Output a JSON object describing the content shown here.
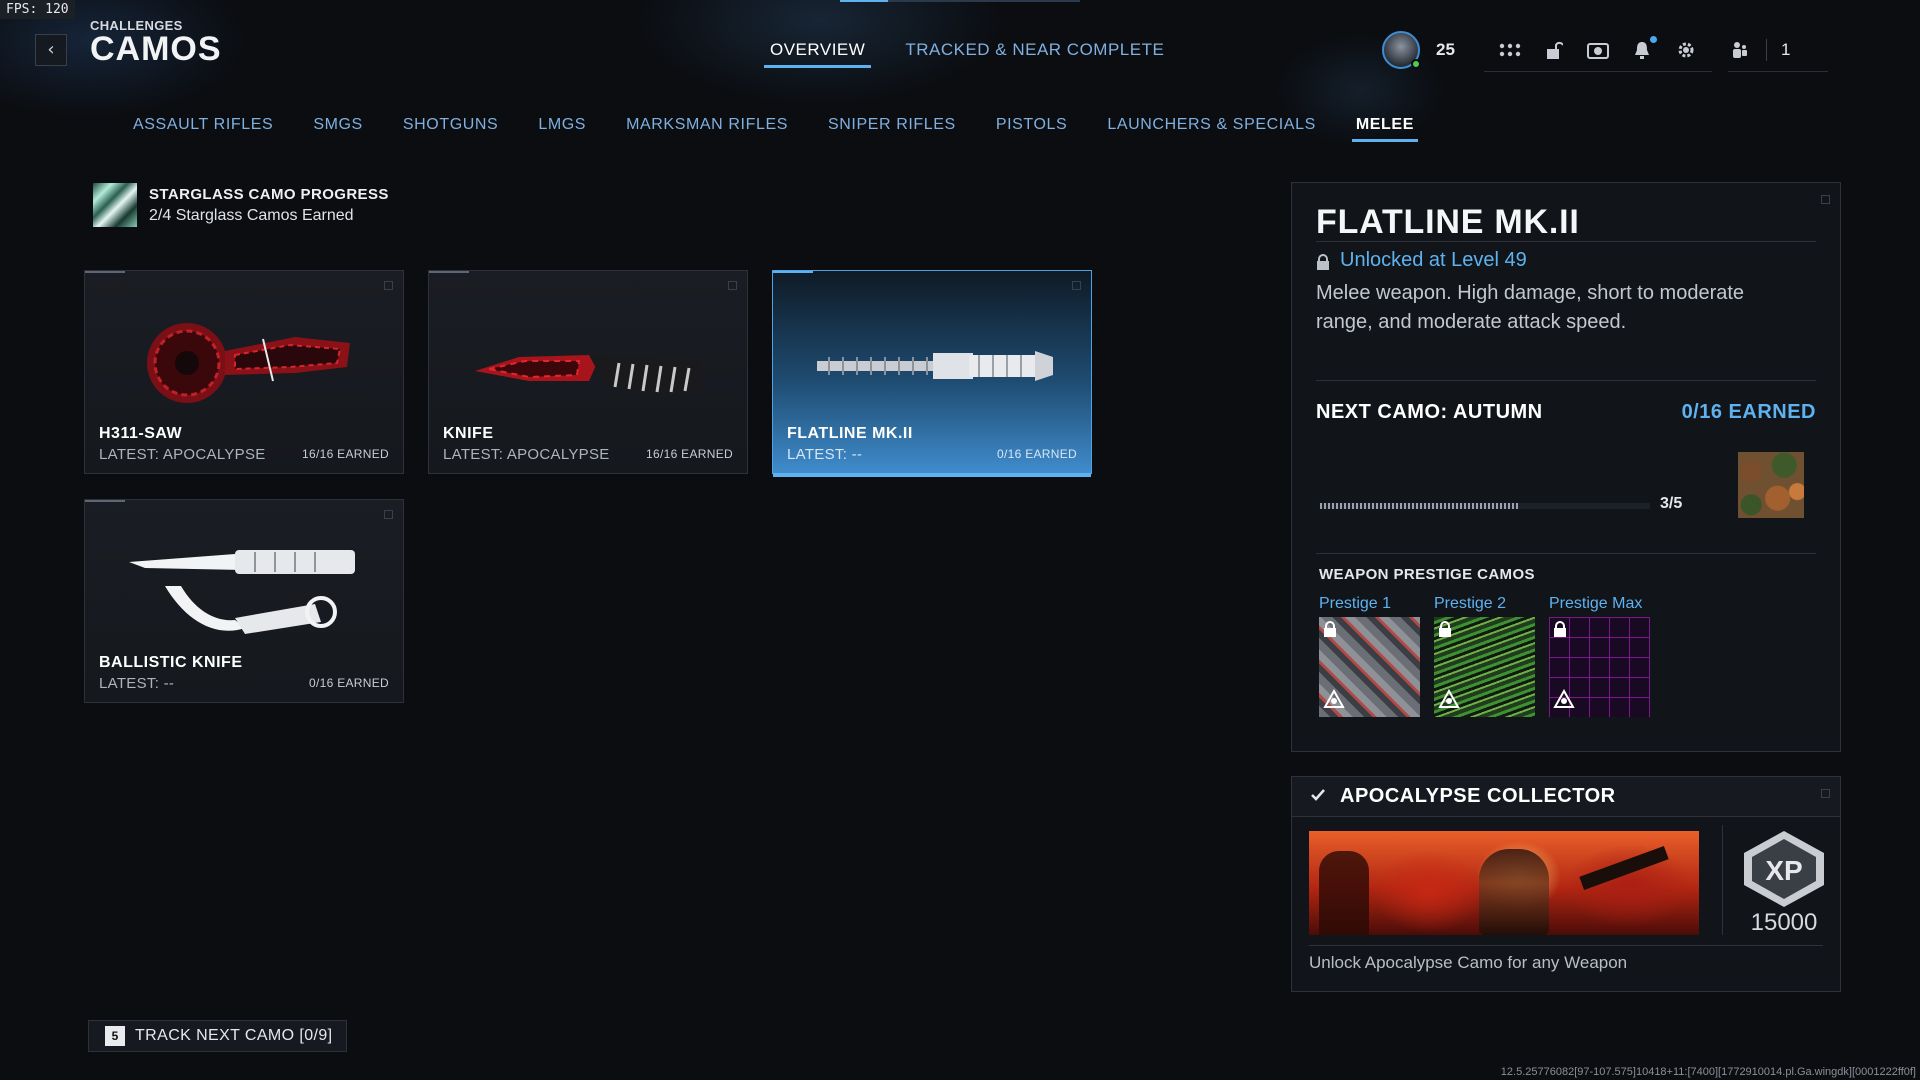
{
  "fps": "FPS: 120",
  "header": {
    "crumb": "CHALLENGES",
    "title": "CAMOS",
    "back_icon": "chevron-left-icon"
  },
  "top_tabs": [
    {
      "label": "OVERVIEW",
      "active": true
    },
    {
      "label": "TRACKED & NEAR COMPLETE",
      "active": false
    }
  ],
  "hud": {
    "level": "25",
    "party_count": "1",
    "icons": [
      "grid-icon",
      "unlock-icon",
      "camera-icon",
      "bell-icon",
      "gear-icon",
      "party-icon"
    ]
  },
  "categories": [
    {
      "label": "ASSAULT RIFLES",
      "active": false
    },
    {
      "label": "SMGS",
      "active": false
    },
    {
      "label": "SHOTGUNS",
      "active": false
    },
    {
      "label": "LMGS",
      "active": false
    },
    {
      "label": "MARKSMAN RIFLES",
      "active": false
    },
    {
      "label": "SNIPER RIFLES",
      "active": false
    },
    {
      "label": "PISTOLS",
      "active": false
    },
    {
      "label": "LAUNCHERS & SPECIALS",
      "active": false
    },
    {
      "label": "MELEE",
      "active": true
    }
  ],
  "starglass": {
    "title": "STARGLASS CAMO PROGRESS",
    "subtitle": "2/4 Starglass Camos Earned"
  },
  "weapons": [
    {
      "name": "H311-SAW",
      "latest": "LATEST: APOCALYPSE",
      "earned": "16/16 EARNED",
      "selected": false
    },
    {
      "name": "KNIFE",
      "latest": "LATEST: APOCALYPSE",
      "earned": "16/16 EARNED",
      "selected": false
    },
    {
      "name": "FLATLINE MK.II",
      "latest": "LATEST: --",
      "earned": "0/16 EARNED",
      "selected": true
    },
    {
      "name": "BALLISTIC KNIFE",
      "latest": "LATEST: --",
      "earned": "0/16 EARNED",
      "selected": false
    }
  ],
  "detail": {
    "name": "FLATLINE MK.II",
    "unlock": "Unlocked at Level 49",
    "description": "Melee weapon. High damage, short to moderate range, and moderate attack speed.",
    "next_camo": "NEXT CAMO: AUTUMN",
    "next_earned": "0/16 EARNED",
    "progress_text": "3/5",
    "progress_fraction": 0.6,
    "prestige_title": "WEAPON PRESTIGE CAMOS",
    "prestige": [
      {
        "label": "Prestige 1"
      },
      {
        "label": "Prestige 2"
      },
      {
        "label": "Prestige Max"
      }
    ]
  },
  "collector": {
    "title": "APOCALYPSE COLLECTOR",
    "xp": "15000",
    "description": "Unlock Apocalypse Camo for any Weapon"
  },
  "track_button": {
    "key": "5",
    "label": "TRACK NEXT CAMO [0/9]"
  },
  "build_info": "12.5.25776082[97-107.575]10418+11:[7400][1772910014.pl.Ga.wingdk][0001222ff0f]"
}
